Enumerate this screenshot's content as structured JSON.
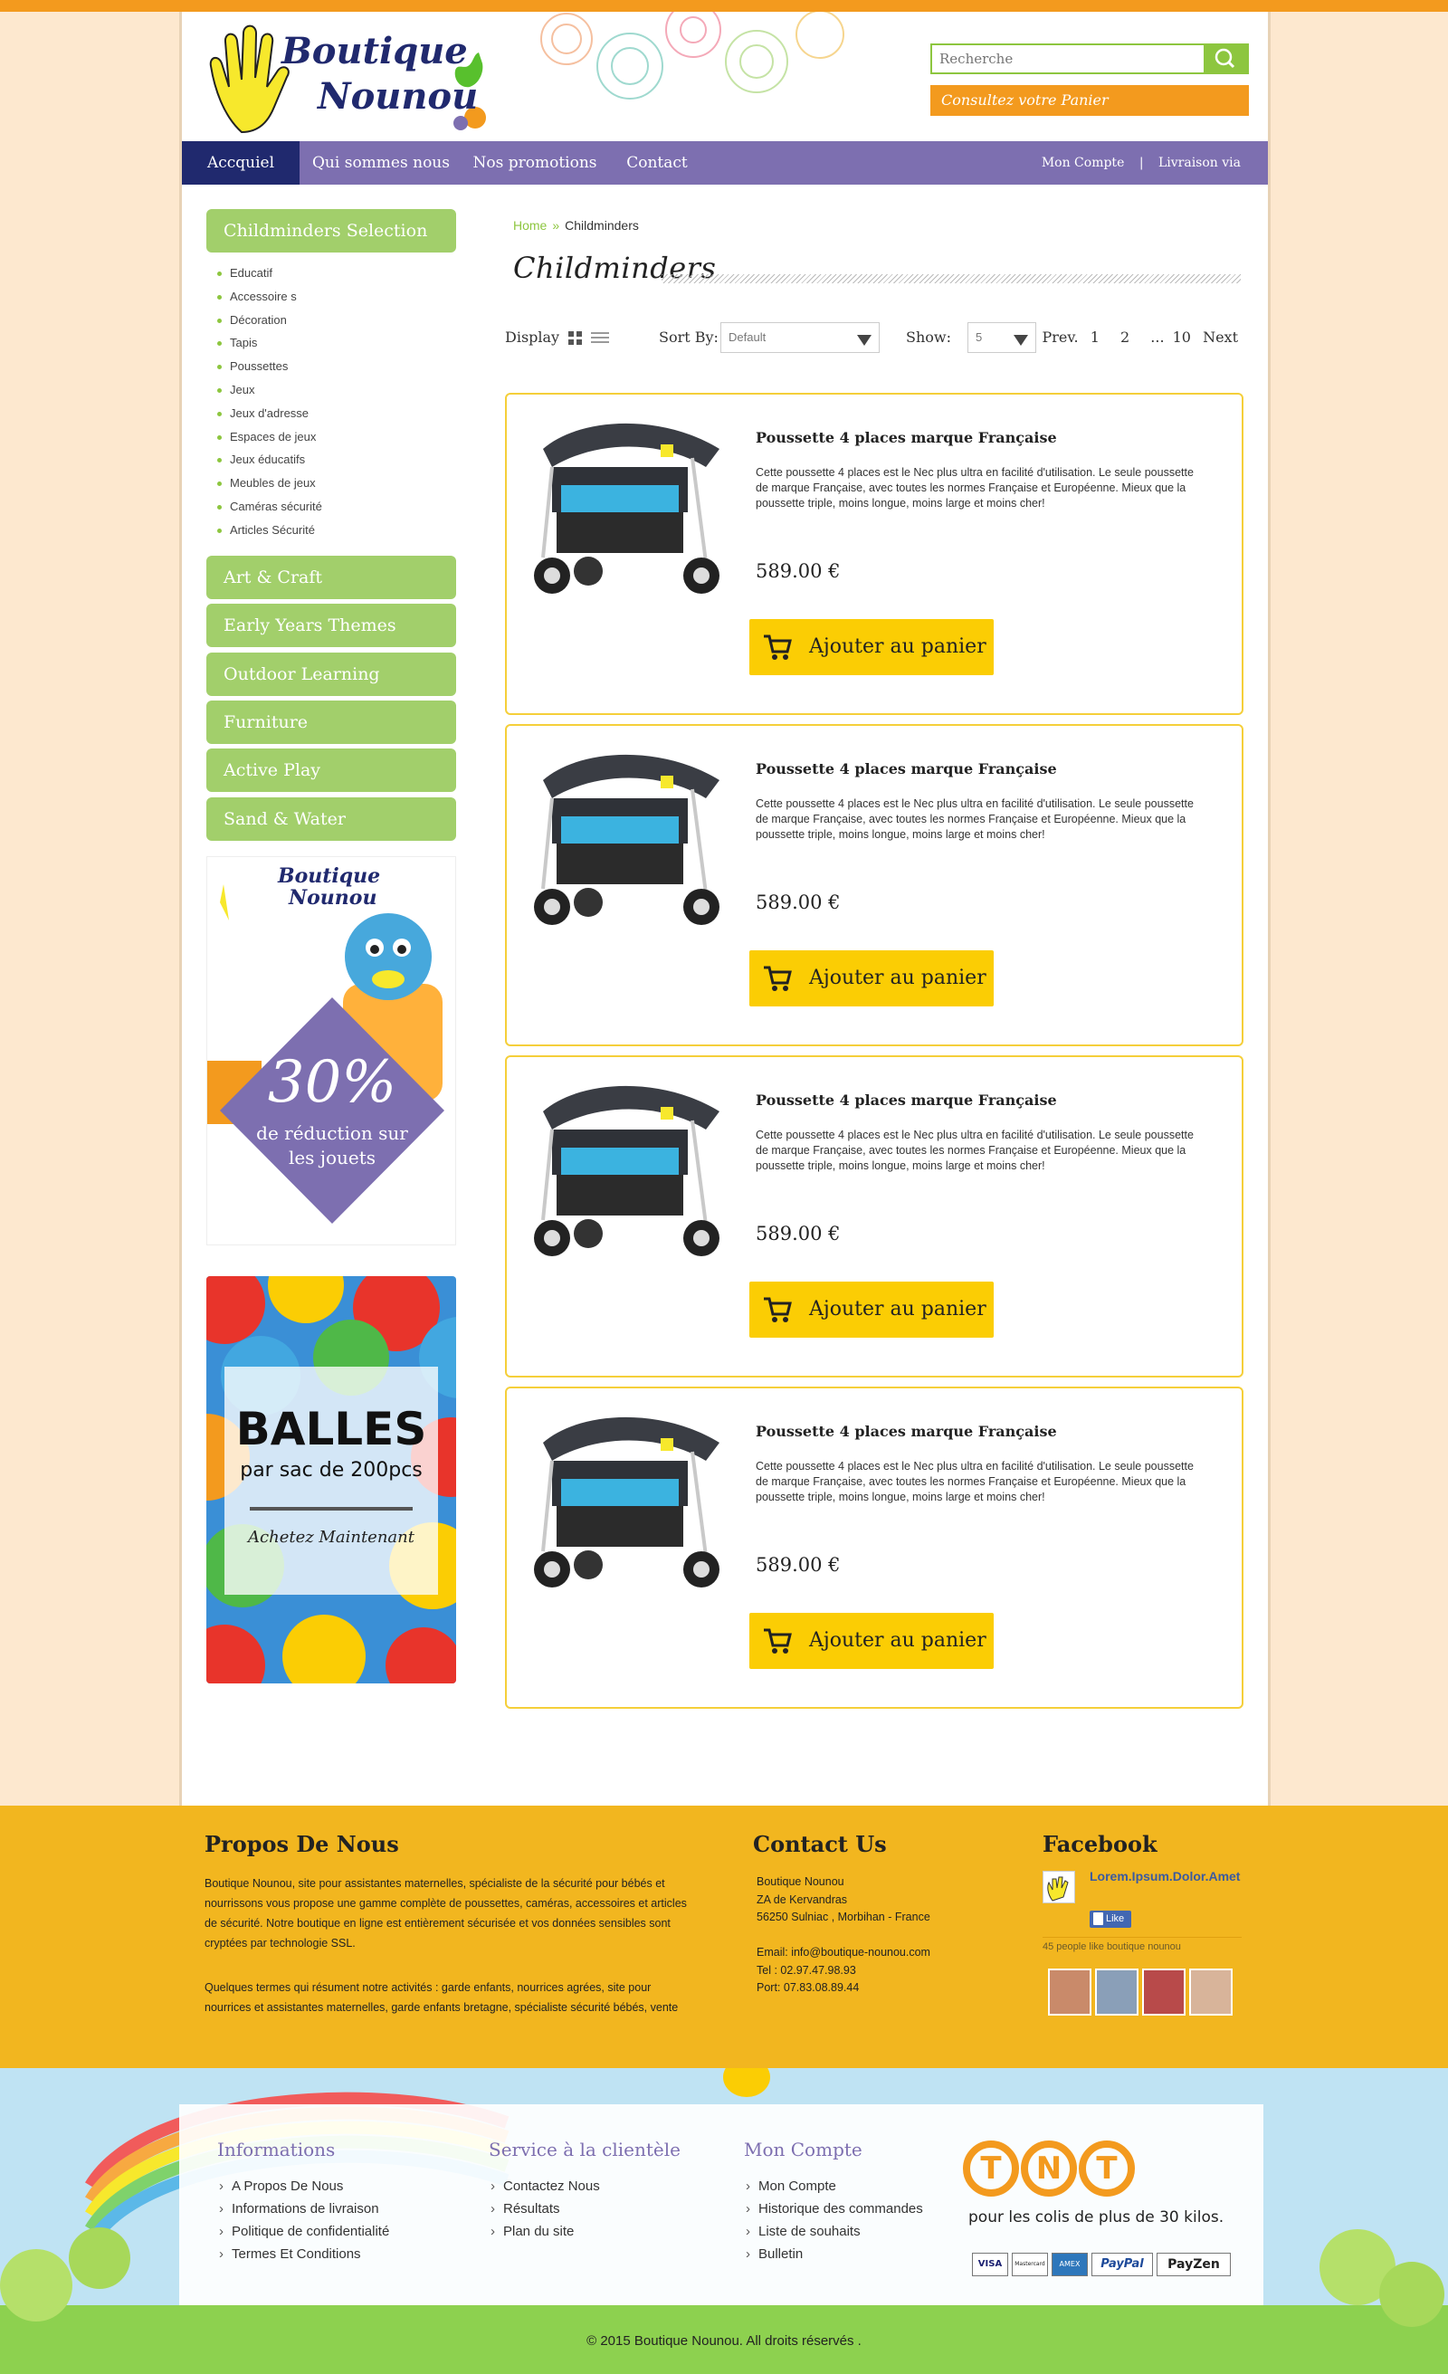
{
  "header": {
    "logo_line1": "Boutique",
    "logo_line2": "Nounou",
    "search_placeholder": "Recherche",
    "cart_link": "Consultez votre Panier"
  },
  "nav": {
    "items": [
      {
        "label": "Accquiel",
        "active": true
      },
      {
        "label": "Qui sommes nous"
      },
      {
        "label": "Nos promotions"
      },
      {
        "label": "Contact"
      }
    ],
    "account": "Mon Compte",
    "separator": "|",
    "delivery": "Livraison via"
  },
  "sidebar": {
    "selection": "Childminders Selection",
    "items": [
      "Educatif",
      "Accessoire s",
      "Décoration",
      "Tapis",
      "Poussettes",
      "Jeux",
      "Jeux d'adresse",
      "Espaces de jeux",
      "Jeux éducatifs",
      "Meubles de jeux",
      "Caméras sécurité",
      "Articles Sécurité"
    ],
    "categories": [
      "Art & Craft",
      "Early Years Themes",
      "Outdoor Learning",
      "Furniture",
      "Active Play",
      "Sand & Water"
    ],
    "promo1": {
      "logo1": "Boutique",
      "logo2": "Nounou",
      "percent": "30%",
      "line1": "de réduction sur",
      "line2": "les jouets"
    },
    "promo2": {
      "title": "BALLES",
      "subtitle": "par sac de 200pcs",
      "cta": "Achetez Maintenant"
    }
  },
  "breadcrumb": {
    "home": "Home",
    "sep": "»",
    "current": "Childminders"
  },
  "page_title": "Childminders",
  "toolbar": {
    "display": "Display",
    "sort_label": "Sort By:",
    "sort_value": "Default",
    "show_label": "Show:",
    "show_value": "5",
    "pager": [
      "Prev.",
      "1",
      "2",
      "...",
      "10",
      "Next"
    ]
  },
  "products": [
    {
      "name": "Poussette 4 places marque Française",
      "desc": "Cette poussette 4 places est le Nec plus ultra en facilité d'utilisation.  Le seule poussette de marque Française, avec toutes les normes Française et Européenne. Mieux que la poussette triple, moins longue, moins large et moins cher!",
      "price": "589.00 €",
      "button": "Ajouter au panier"
    },
    {
      "name": "Poussette 4 places marque Française",
      "desc": "Cette poussette 4 places est le Nec plus ultra en facilité d'utilisation.  Le seule poussette de marque Française, avec toutes les normes Française et Européenne. Mieux que la poussette triple, moins longue, moins large et moins cher!",
      "price": "589.00 €",
      "button": "Ajouter au panier"
    },
    {
      "name": "Poussette 4 places marque Française",
      "desc": "Cette poussette 4 places est le Nec plus ultra en facilité d'utilisation.  Le seule poussette de marque Française, avec toutes les normes Française et Européenne. Mieux que la poussette triple, moins longue, moins large et moins cher!",
      "price": "589.00 €",
      "button": "Ajouter au panier"
    },
    {
      "name": "Poussette 4 places marque Française",
      "desc": "Cette poussette 4 places est le Nec plus ultra en facilité d'utilisation.  Le seule poussette de marque Française, avec toutes les normes Française et Européenne. Mieux que la poussette triple, moins longue, moins large et moins cher!",
      "price": "589.00 €",
      "button": "Ajouter au panier"
    }
  ],
  "footer": {
    "about_title": "Propos De Nous",
    "about_p1": "Boutique Nounou, site pour assistantes maternelles, spécialiste de la sécurité pour bébés et nourrissons vous propose une gamme complète de poussettes, caméras, accessoires et articles de sécurité. Notre boutique en ligne est entièrement sécurisée et vos données sensibles sont cryptées par technologie SSL.",
    "about_p2": "Quelques termes qui résument notre activités : garde enfants, nourrices agrées, site pour nourrices et assistantes maternelles, garde enfants bretagne, spécialiste sécurité bébés, vente",
    "contact_title": "Contact Us",
    "contact_lines": [
      "Boutique Nounou",
      "ZA de Kervandras",
      "56250 Sulniac , Morbihan - France",
      "",
      "Email: info@boutique-nounou.com",
      "Tel : 02.97.47.98.93",
      "Port: 07.83.08.89.44"
    ],
    "facebook_title": "Facebook",
    "fb_name": "Lorem.Ipsum.Dolor.Amet",
    "fb_like": "Like",
    "fb_count": "45 people like boutique nounou"
  },
  "bottom": {
    "informations_title": "Informations",
    "informations": [
      "A Propos De Nous",
      "Informations de livraison",
      "Politique de confidentialité",
      "Termes Et Conditions"
    ],
    "service_title": "Service à la clientèle",
    "service": [
      "Contactez Nous",
      "Résultats",
      "Plan du site"
    ],
    "account_title": "Mon Compte",
    "account": [
      "Mon Compte",
      "Historique des commandes",
      "Liste de souhaits",
      "Bulletin"
    ],
    "tnt_letters": [
      "T",
      "N",
      "T"
    ],
    "tnt_text": "pour les colis de plus de 30 kilos.",
    "payments": [
      "VISA",
      "Mastercard",
      "AMEX",
      "PayPal",
      "PayZen"
    ],
    "copyright": "© 2015 Boutique Nounou. All droits réservés ."
  },
  "colors": {
    "green": "#8dc63f",
    "orange": "#f39a1e",
    "purple": "#7d6fb0",
    "navy": "#20296e",
    "yellow": "#fbcd04",
    "footer": "#f2b61f"
  }
}
